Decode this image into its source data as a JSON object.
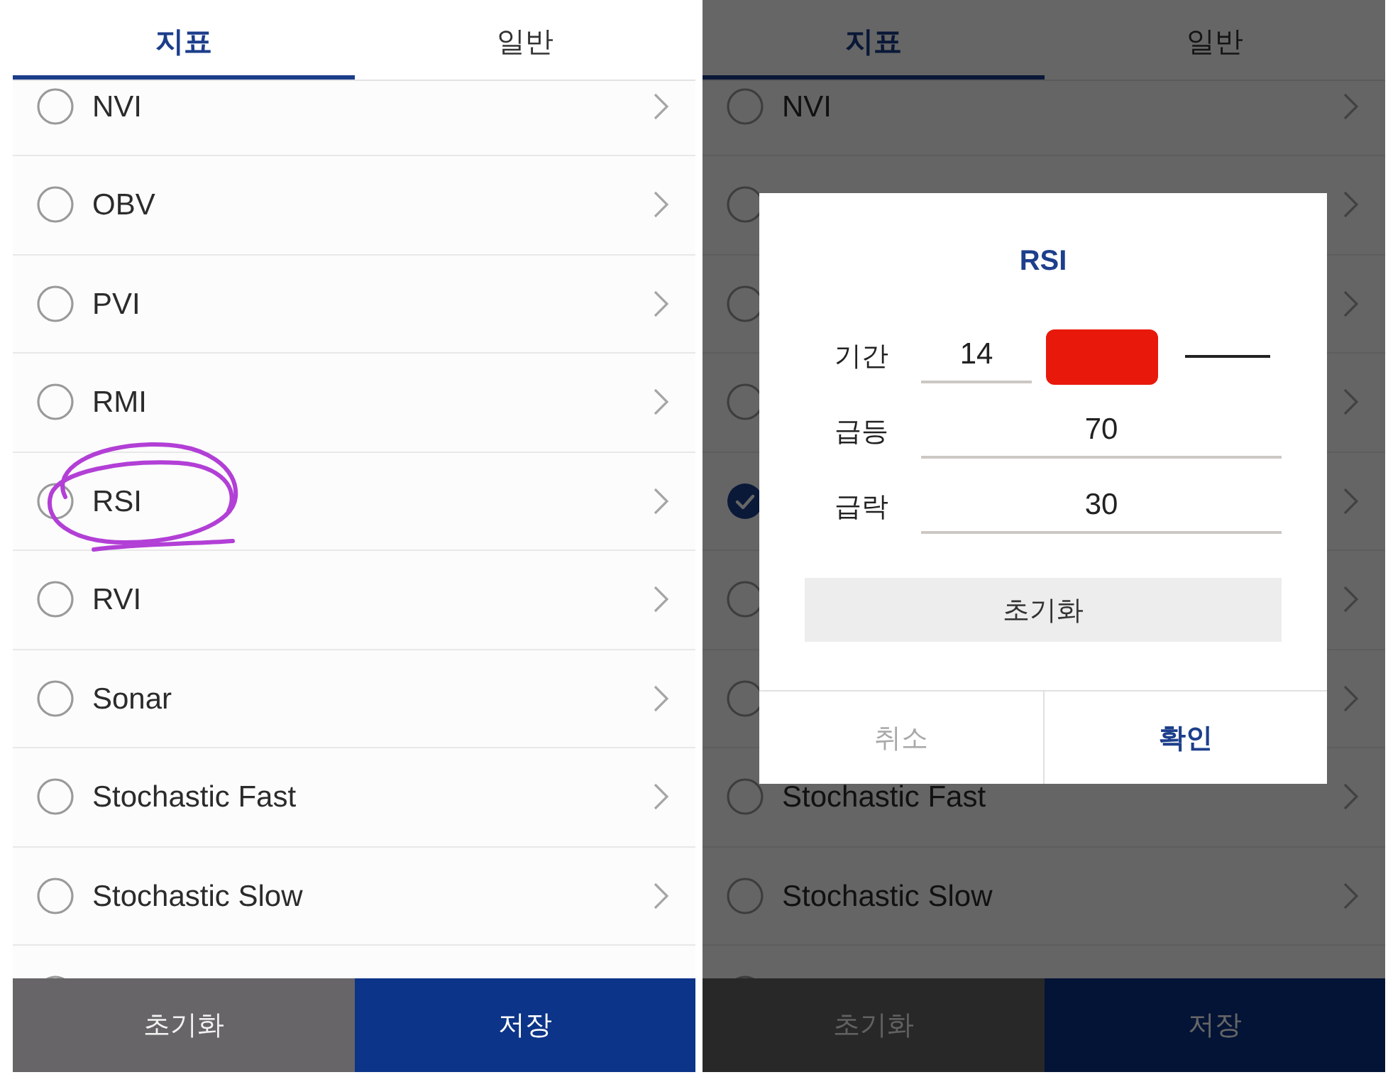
{
  "screens": [
    {
      "tabs": [
        {
          "label": "지표",
          "selected": true
        },
        {
          "label": "일반",
          "selected": false
        }
      ],
      "items": [
        {
          "label": "NVI",
          "checked": false,
          "circled": false
        },
        {
          "label": "OBV",
          "checked": false,
          "circled": false
        },
        {
          "label": "PVI",
          "checked": false,
          "circled": false
        },
        {
          "label": "RMI",
          "checked": false,
          "circled": false
        },
        {
          "label": "RSI",
          "checked": false,
          "circled": true
        },
        {
          "label": "RVI",
          "checked": false,
          "circled": false
        },
        {
          "label": "Sonar",
          "checked": false,
          "circled": false
        },
        {
          "label": "Stochastic Fast",
          "checked": false,
          "circled": false
        },
        {
          "label": "Stochastic Slow",
          "checked": false,
          "circled": false
        },
        {
          "checked": false,
          "circled": false
        }
      ],
      "footer_buttons": [
        {
          "label": "초기화",
          "kind": "reset"
        },
        {
          "label": "저장",
          "kind": "save"
        }
      ]
    },
    {
      "tabs": [
        {
          "label": "지표",
          "selected": true
        },
        {
          "label": "일반",
          "selected": false
        }
      ],
      "items": [
        {
          "label": "NVI",
          "checked": false
        },
        {
          "checked": false
        },
        {
          "checked": false
        },
        {
          "checked": false
        },
        {
          "checked": true
        },
        {
          "checked": false
        },
        {
          "checked": false
        },
        {
          "label": "Stochastic Fast",
          "checked": false
        },
        {
          "label": "Stochastic Slow",
          "checked": false
        },
        {
          "checked": false
        }
      ],
      "footer_buttons": [
        {
          "label": "초기화",
          "kind": "reset"
        },
        {
          "label": "저장",
          "kind": "save"
        }
      ],
      "dialog": {
        "title": "RSI",
        "fields": [
          {
            "kind": "line",
            "label": "기간",
            "value": "14",
            "color": "#e8190b"
          },
          {
            "kind": "level",
            "label": "급등",
            "value": "70"
          },
          {
            "kind": "level",
            "label": "급락",
            "value": "30"
          }
        ],
        "reset_button": "초기화",
        "buttons": [
          {
            "label": "취소",
            "kind": "cancel"
          },
          {
            "label": "확인",
            "kind": "confirm"
          }
        ]
      }
    }
  ]
}
